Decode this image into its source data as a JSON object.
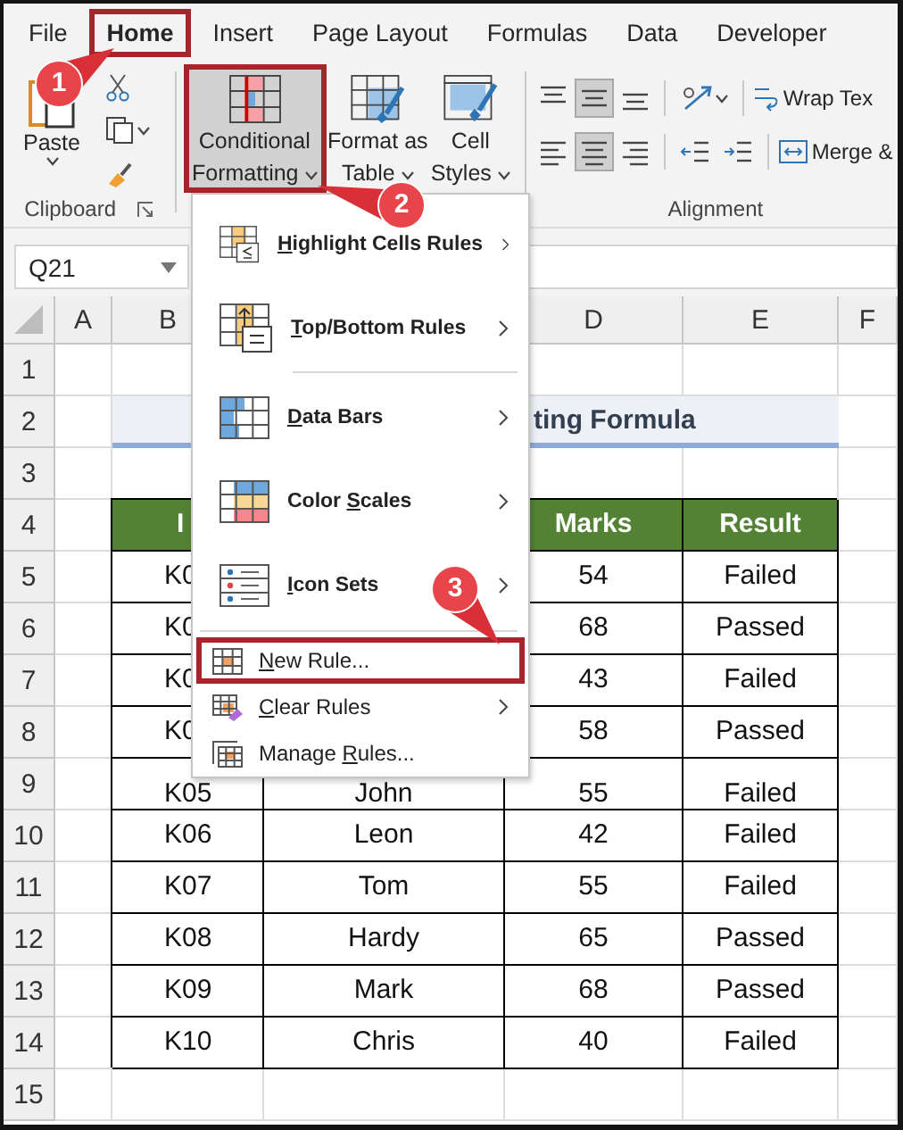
{
  "ribbon_tabs": [
    {
      "label": "File",
      "selected": false,
      "outlined": false
    },
    {
      "label": "Home",
      "selected": true,
      "outlined": true
    },
    {
      "label": "Insert",
      "selected": false,
      "outlined": false
    },
    {
      "label": "Page Layout",
      "selected": false,
      "outlined": false
    },
    {
      "label": "Formulas",
      "selected": false,
      "outlined": false
    },
    {
      "label": "Data",
      "selected": false,
      "outlined": false
    },
    {
      "label": "Developer",
      "selected": false,
      "outlined": false
    }
  ],
  "clipboard": {
    "paste_label": "Paste",
    "group_label": "Clipboard"
  },
  "style_buttons": [
    {
      "kind": "conditional_formatting",
      "lines": [
        "Conditional",
        "Formatting"
      ],
      "pressed": true,
      "outlined": true
    },
    {
      "kind": "format_as_table",
      "lines": [
        "Format as",
        "Table"
      ],
      "pressed": false,
      "outlined": false
    },
    {
      "kind": "cell_styles",
      "lines": [
        "Cell",
        "Styles"
      ],
      "pressed": false,
      "outlined": false
    }
  ],
  "alignment": {
    "group_label": "Alignment",
    "wrap_text": "Wrap Tex",
    "merge": "Merge &",
    "rows": [
      [
        {
          "kind": "align_top",
          "pressed": false
        },
        {
          "kind": "align_middle",
          "pressed": true
        },
        {
          "kind": "align_bottom",
          "pressed": false
        },
        {
          "kind": "orientation",
          "pressed": false
        }
      ],
      [
        {
          "kind": "align_left",
          "pressed": false
        },
        {
          "kind": "align_center",
          "pressed": true
        },
        {
          "kind": "align_right",
          "pressed": false
        },
        {
          "kind": "indent_decrease",
          "pressed": false
        },
        {
          "kind": "indent_increase",
          "pressed": false
        }
      ]
    ]
  },
  "name_box": {
    "value": "Q21"
  },
  "sheet": {
    "columns": [
      "A",
      "B",
      "D",
      "E",
      "F"
    ],
    "rows": [
      "1",
      "2",
      "3",
      "4",
      "5",
      "6",
      "7",
      "8",
      "9",
      "10",
      "11",
      "12",
      "13",
      "14",
      "15"
    ],
    "title": "ting Formula",
    "table_header": {
      "col_b": "I",
      "col_d": "Marks",
      "col_e": "Result"
    },
    "table_rows": [
      {
        "col_b": "K0",
        "col_d": "54",
        "col_e": "Failed"
      },
      {
        "col_b": "K0",
        "col_d": "68",
        "col_e": "Passed"
      },
      {
        "col_b": "K0",
        "col_d": "43",
        "col_e": "Failed"
      },
      {
        "col_b": "K0",
        "col_d": "58",
        "col_e": "Passed"
      },
      {
        "col_b": "K05",
        "col_c": "John",
        "col_d": "55",
        "col_e": "Failed"
      },
      {
        "col_b": "K06",
        "col_c": "Leon",
        "col_d": "42",
        "col_e": "Failed"
      },
      {
        "col_b": "K07",
        "col_c": "Tom",
        "col_d": "55",
        "col_e": "Failed"
      },
      {
        "col_b": "K08",
        "col_c": "Hardy",
        "col_d": "65",
        "col_e": "Passed"
      },
      {
        "col_b": "K09",
        "col_c": "Mark",
        "col_d": "68",
        "col_e": "Passed"
      },
      {
        "col_b": "K10",
        "col_c": "Chris",
        "col_d": "40",
        "col_e": "Failed"
      }
    ]
  },
  "menu": {
    "items": [
      {
        "kind": "gallery",
        "key": "H",
        "post": "ighlight Cells Rules",
        "submenu": true,
        "outlined": false
      },
      {
        "kind": "gallery",
        "key": "T",
        "post": "op/Bottom Rules",
        "submenu": true,
        "outlined": false
      },
      {
        "kind": "separator"
      },
      {
        "kind": "gallery",
        "key": "D",
        "post": "ata Bars",
        "submenu": true,
        "outlined": false
      },
      {
        "kind": "gallery",
        "pre": "Color ",
        "key": "S",
        "post": "cales",
        "submenu": true,
        "outlined": false
      },
      {
        "kind": "gallery",
        "key": "I",
        "post": "con Sets",
        "submenu": true,
        "outlined": false
      },
      {
        "kind": "separator"
      },
      {
        "kind": "command",
        "key": "N",
        "post": "ew Rule...",
        "submenu": false,
        "outlined": true
      },
      {
        "kind": "command",
        "key": "C",
        "post": "lear Rules",
        "submenu": true,
        "outlined": false
      },
      {
        "kind": "command",
        "pre": "Manage ",
        "key": "R",
        "post": "ules...",
        "submenu": false,
        "outlined": false
      }
    ]
  },
  "callouts": [
    "1",
    "2",
    "3"
  ]
}
